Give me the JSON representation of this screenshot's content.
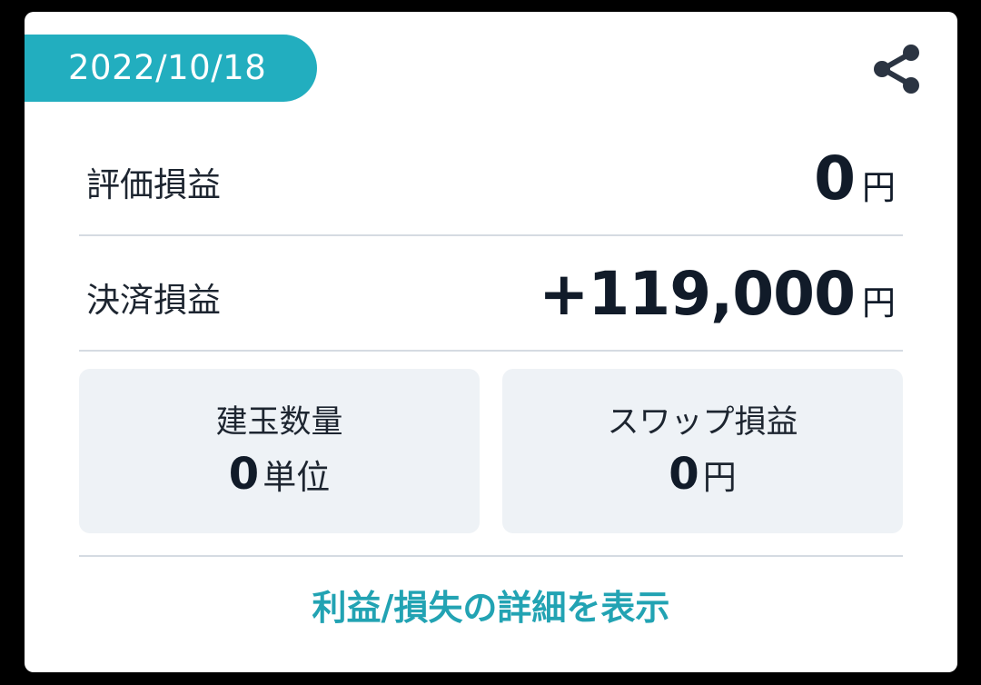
{
  "header": {
    "date": "2022/10/18",
    "share_icon": "share-icon"
  },
  "valuation_pl": {
    "label": "評価損益",
    "value": "0",
    "unit": "円"
  },
  "settlement_pl": {
    "label": "決済損益",
    "value": "+119,000",
    "unit": "円"
  },
  "position_quantity": {
    "label": "建玉数量",
    "value": "0",
    "unit": "単位"
  },
  "swap_pl": {
    "label": "スワップ損益",
    "value": "0",
    "unit": "円"
  },
  "footer": {
    "detail_link": "利益/損失の詳細を表示"
  },
  "colors": {
    "accent": "#22aebf",
    "link": "#22a3b3",
    "stat_background": "#eef2f6"
  }
}
